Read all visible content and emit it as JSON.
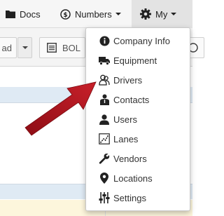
{
  "navbar": {
    "docs_label": "Docs",
    "numbers_label": "Numbers",
    "my_label": "My"
  },
  "toolbar": {
    "upload_fragment": "ad",
    "bol_label": "BOL"
  },
  "my_menu": {
    "items": [
      {
        "label": "Company Info",
        "icon": "info-circle-icon"
      },
      {
        "label": "Equipment",
        "icon": "truck-icon"
      },
      {
        "label": "Drivers",
        "icon": "drivers-icon"
      },
      {
        "label": "Contacts",
        "icon": "contact-person-icon"
      },
      {
        "label": "Users",
        "icon": "user-icon"
      },
      {
        "label": "Lanes",
        "icon": "route-icon"
      },
      {
        "label": "Vendors",
        "icon": "wrench-icon"
      },
      {
        "label": "Locations",
        "icon": "map-marker-icon"
      },
      {
        "label": "Settings",
        "icon": "sliders-icon"
      }
    ]
  },
  "colors": {
    "pointer_arrow": "#b3121d",
    "row_highlight": "#dfeaf4",
    "row_warning": "#fdf6dc"
  }
}
